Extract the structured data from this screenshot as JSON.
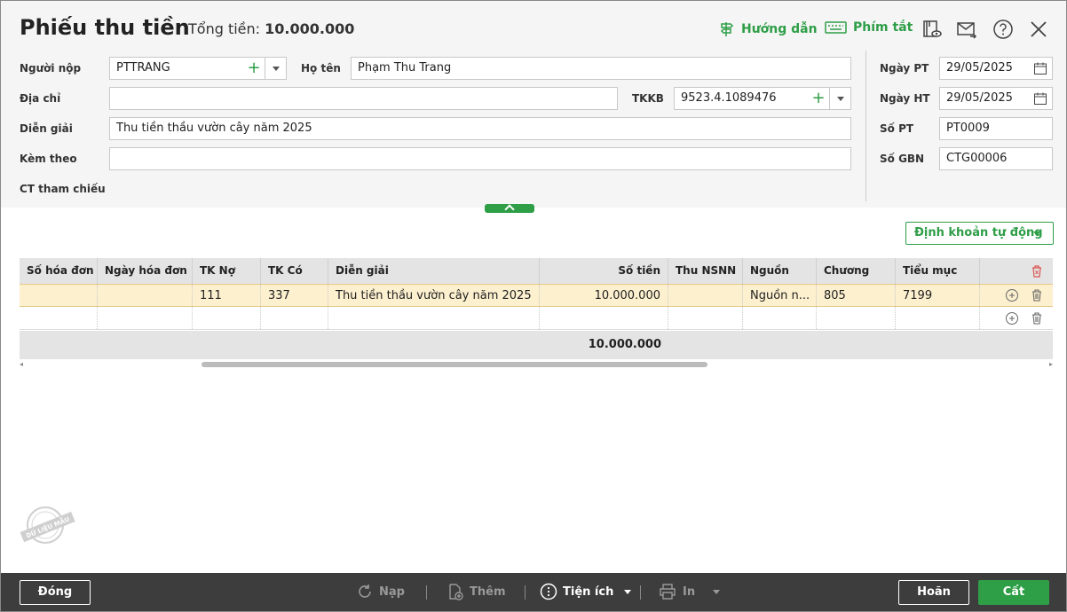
{
  "header": {
    "title": "Phiếu thu tiền",
    "total_label": "Tổng tiền:",
    "total_value": "10.000.000"
  },
  "toolbar": {
    "guide": "Hướng dẫn",
    "shortcut": "Phím tắt",
    "icons": [
      "view-icon",
      "send-mail-icon",
      "help-icon",
      "close-icon"
    ]
  },
  "form": {
    "payer_label": "Người nộp",
    "payer_value": "PTTRANG",
    "name_label": "Họ tên",
    "name_value": "Phạm Thu Trang",
    "address_label": "Địa chỉ",
    "address_value": "",
    "tkkb_label": "TKKB",
    "tkkb_value": "9523.4.1089476",
    "desc_label": "Diễn giải",
    "desc_value": "Thu tiền thầu vườn cây năm 2025",
    "attach_label": "Kèm theo",
    "attach_value": "",
    "ref_label": "CT tham chiếu",
    "date_pt_label": "Ngày PT",
    "date_pt_value": "29/05/2025",
    "date_ht_label": "Ngày HT",
    "date_ht_value": "29/05/2025",
    "so_pt_label": "Số PT",
    "so_pt_value": "PT0009",
    "so_gbn_label": "Số GBN",
    "so_gbn_value": "CTG00006"
  },
  "auto_button": "Định khoản tự động",
  "table": {
    "columns": [
      "Số hóa đơn",
      "Ngày hóa đơn",
      "TK Nợ",
      "TK Có",
      "Diễn giải",
      "Số tiền",
      "Thu NSNN",
      "Nguồn",
      "Chương",
      "Tiểu mục"
    ],
    "rows": [
      [
        "",
        "",
        "111",
        "337",
        "Thu tiền thầu vườn cây năm 2025",
        "10.000.000",
        "",
        "Nguồn n...",
        "805",
        "7199"
      ],
      [
        "",
        "",
        "",
        "",
        "",
        "",
        "",
        "",
        "",
        ""
      ]
    ],
    "footer_total": "10.000.000"
  },
  "stamp": "DỮ LIỆU MẪU",
  "bottom": {
    "close": "Đóng",
    "reload": "Nạp",
    "add": "Thêm",
    "utility": "Tiện ích",
    "print": "In",
    "cancel": "Hoãn",
    "save": "Cất"
  },
  "colors": {
    "accent": "#2e9e47",
    "selected_row": "#fdf0cf",
    "footer_bar": "#3d3d3d"
  }
}
